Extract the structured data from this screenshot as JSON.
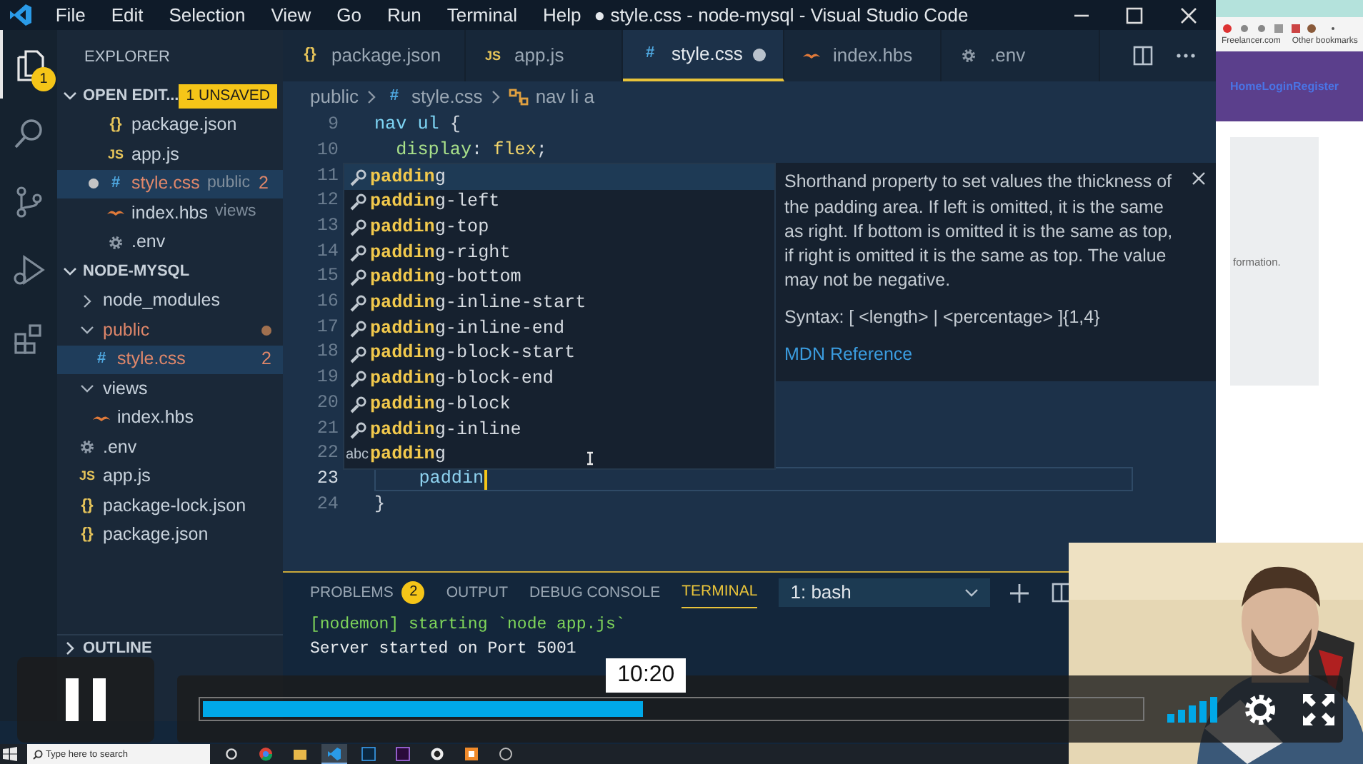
{
  "title_bar": {
    "menu": [
      "File",
      "Edit",
      "Selection",
      "View",
      "Go",
      "Run",
      "Terminal",
      "Help"
    ],
    "title": "● style.css - node-mysql - Visual Studio Code"
  },
  "activity_bar": [
    {
      "kind": "explorer",
      "badge": "1",
      "selected": true
    },
    {
      "kind": "search",
      "selected": false
    },
    {
      "kind": "source-control",
      "selected": false
    },
    {
      "kind": "run",
      "selected": false
    },
    {
      "kind": "extensions",
      "selected": false
    }
  ],
  "sidebar": {
    "title": "EXPLORER",
    "open_editors": {
      "label": "OPEN EDIT...",
      "badge": "1 UNSAVED",
      "expanded": true,
      "items": [
        {
          "kind": "json",
          "icon": "{}",
          "name": "package.json",
          "dirty": false,
          "selected": false
        },
        {
          "kind": "js",
          "icon": "JS",
          "name": "app.js",
          "dirty": false,
          "selected": false
        },
        {
          "kind": "css",
          "icon": "#",
          "name": "style.css",
          "folder": "public",
          "problems": "2",
          "dirty": true,
          "selected": true
        },
        {
          "kind": "hbs",
          "name": "index.hbs",
          "folder": "views",
          "dirty": false,
          "selected": false
        },
        {
          "kind": "env",
          "name": ".env",
          "dirty": false,
          "selected": false
        }
      ]
    },
    "project": {
      "label": "NODE-MYSQL",
      "expanded": true,
      "children": [
        {
          "kind": "folder",
          "name": "node_modules",
          "expanded": false,
          "error": false,
          "selected": false
        },
        {
          "kind": "folder",
          "name": "public",
          "expanded": true,
          "error": true,
          "selected": false,
          "children": [
            {
              "kind": "css",
              "icon": "#",
              "name": "style.css",
              "problems": "2",
              "error": true,
              "selected": true
            }
          ]
        },
        {
          "kind": "folder",
          "name": "views",
          "expanded": true,
          "error": false,
          "selected": false,
          "children": [
            {
              "kind": "hbs",
              "name": "index.hbs",
              "error": false,
              "selected": false
            }
          ]
        },
        {
          "kind": "env",
          "name": ".env",
          "error": false,
          "selected": false
        },
        {
          "kind": "js",
          "icon": "JS",
          "name": "app.js",
          "error": false,
          "selected": false
        },
        {
          "kind": "json",
          "icon": "{}",
          "name": "package-lock.json",
          "error": false,
          "selected": false
        },
        {
          "kind": "json",
          "icon": "{}",
          "name": "package.json",
          "error": false,
          "selected": false
        }
      ]
    },
    "sections": [
      {
        "label": "OUTLINE",
        "expanded": false
      }
    ]
  },
  "editor_tabs": [
    {
      "kind": "json",
      "icon": "{}",
      "label": "package.json",
      "selected": false,
      "dirty": false
    },
    {
      "kind": "js",
      "icon": "JS",
      "label": "app.js",
      "selected": false,
      "dirty": false
    },
    {
      "kind": "css",
      "icon": "#",
      "label": "style.css",
      "selected": true,
      "dirty": true
    },
    {
      "kind": "hbs",
      "label": "index.hbs",
      "selected": false,
      "dirty": false
    },
    {
      "kind": "env",
      "label": ".env",
      "selected": false,
      "dirty": false
    }
  ],
  "breadcrumbs": [
    {
      "kind": "folder",
      "label": "public"
    },
    {
      "kind": "css",
      "icon": "#",
      "label": "style.css"
    },
    {
      "kind": "symbol",
      "label": "nav li a"
    }
  ],
  "code_lines": [
    {
      "number": "9",
      "current": false,
      "tokens": [
        {
          "kind": "selector",
          "text": "nav ul"
        },
        {
          "kind": "punct",
          "text": " {"
        }
      ]
    },
    {
      "number": "10",
      "current": false,
      "tokens": [
        {
          "kind": "property",
          "text": "  display"
        },
        {
          "kind": "punct",
          "text": ": "
        },
        {
          "kind": "value",
          "text": "flex"
        },
        {
          "kind": "punct",
          "text": ";"
        }
      ]
    },
    {
      "number": "11",
      "current": false
    },
    {
      "number": "12",
      "current": false
    },
    {
      "number": "13",
      "current": false
    },
    {
      "number": "14",
      "current": false
    },
    {
      "number": "15",
      "current": false
    },
    {
      "number": "16",
      "current": false
    },
    {
      "number": "17",
      "current": false
    },
    {
      "number": "18",
      "current": false
    },
    {
      "number": "19",
      "current": false
    },
    {
      "number": "20",
      "current": false
    },
    {
      "number": "21",
      "current": false
    },
    {
      "number": "22",
      "current": false
    },
    {
      "number": "23",
      "current": true,
      "tokens": [
        {
          "kind": "typed",
          "text": "    paddin"
        }
      ]
    },
    {
      "number": "24",
      "current": false,
      "tokens": [
        {
          "kind": "punct",
          "text": "}"
        }
      ]
    }
  ],
  "suggestions": [
    {
      "kind": "property",
      "label": "**paddin**g",
      "selected": true
    },
    {
      "kind": "property",
      "label": "**paddin**g-left",
      "selected": false
    },
    {
      "kind": "property",
      "label": "**paddin**g-top",
      "selected": false
    },
    {
      "kind": "property",
      "label": "**paddin**g-right",
      "selected": false
    },
    {
      "kind": "property",
      "label": "**paddin**g-bottom",
      "selected": false
    },
    {
      "kind": "property",
      "label": "**paddin**g-inline-start",
      "selected": false
    },
    {
      "kind": "property",
      "label": "**paddin**g-inline-end",
      "selected": false
    },
    {
      "kind": "property",
      "label": "**paddin**g-block-start",
      "selected": false
    },
    {
      "kind": "property",
      "label": "**paddin**g-block-end",
      "selected": false
    },
    {
      "kind": "property",
      "label": "**paddin**g-block",
      "selected": false
    },
    {
      "kind": "property",
      "label": "**paddin**g-inline",
      "selected": false
    },
    {
      "kind": "text",
      "icon": "abc",
      "label": "**paddin**g",
      "selected": false
    }
  ],
  "suggestion_details": {
    "description": "Shorthand property to set values the thickness of the padding area. If left is omitted, it is the same as right. If bottom is omitted it is the same as top, if right is omitted it is the same as top. The value may not be negative.",
    "syntax": "Syntax: [ <length> | <percentage> ]{1,4}",
    "link": "MDN Reference"
  },
  "panel": {
    "tabs": [
      {
        "label": "PROBLEMS",
        "badge": "2",
        "selected": false
      },
      {
        "label": "OUTPUT",
        "selected": false
      },
      {
        "label": "DEBUG CONSOLE",
        "selected": false
      },
      {
        "label": "TERMINAL",
        "selected": true
      }
    ],
    "terminal_select": "1: bash",
    "terminal_lines": [
      {
        "kind": "nodemon",
        "text": "[nodemon] starting `node app.js`"
      },
      {
        "kind": "plain",
        "text": "Server started on Port 5001"
      }
    ]
  },
  "browser": {
    "bookmarks": [
      "Freelancer.com",
      "Other bookmarks"
    ],
    "nav": "HomeLoginRegister",
    "content": "formation."
  },
  "taskbar": {
    "search_placeholder": "Type here to search",
    "apps": [
      {
        "kind": "task-view",
        "selected": false
      },
      {
        "kind": "browser",
        "selected": false
      },
      {
        "kind": "folder",
        "selected": false
      },
      {
        "kind": "editor",
        "selected": true
      },
      {
        "kind": "image-app",
        "selected": false
      },
      {
        "kind": "video-app",
        "selected": false
      },
      {
        "kind": "recorder",
        "selected": false
      },
      {
        "kind": "server",
        "selected": false
      },
      {
        "kind": "misc",
        "selected": false
      }
    ]
  },
  "video_player": {
    "playing": true,
    "progress": {
      "level": 0.47
    },
    "time_tooltip": "10:20"
  }
}
